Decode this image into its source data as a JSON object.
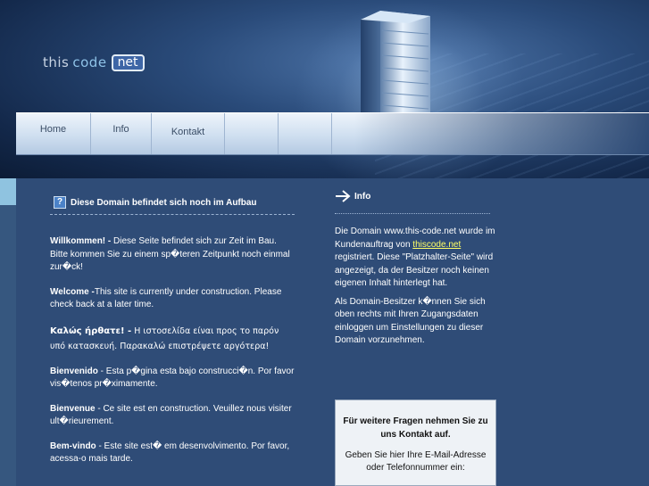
{
  "logo": {
    "part1": "this",
    "part2": "code",
    "part3": "net"
  },
  "nav": {
    "home": "Home",
    "info": "Info",
    "kontakt": "Kontakt"
  },
  "main": {
    "title": "Diese Domain befindet sich noch im Aufbau",
    "paragraphs": [
      {
        "lead": "Willkommen! -",
        "text": " Diese Seite befindet sich zur Zeit im Bau. Bitte kommen Sie zu einem sp�teren Zeitpunkt noch einmal zur�ck!"
      },
      {
        "lead": "Welcome -",
        "text": "This site is currently under construction. Please check back at a later time."
      },
      {
        "lead": "Καλώς ήρθατε! -",
        "text": " Η ιστοσελίδα είναι προς το παρόν υπό κατασκευή. Παρακαλώ επιστρέψετε αργότερα!"
      },
      {
        "lead": "Bienvenido",
        "text": " - Esta p�gina esta bajo construcci�n. Por favor vis�tenos pr�ximamente."
      },
      {
        "lead": "Bienvenue",
        "text": " - Ce site est en construction. Veuillez nous visiter ult�rieurement."
      },
      {
        "lead": "Bem-vindo",
        "text": " - Este site est� em desenvolvimento. Por favor, acessa-o mais tarde."
      }
    ]
  },
  "info": {
    "title": "Info",
    "text_before": "Die Domain www.this-code.net wurde im Kundenauftrag von ",
    "link": "thiscode.net",
    "text_after": " registriert. Diese \"Platzhalter-Seite\" wird angezeigt, da der Besitzer noch keinen eigenen Inhalt hinterlegt hat.",
    "text2": "Als Domain-Besitzer k�nnen Sie sich oben rechts mit Ihren Zugangsdaten einloggen um Einstellungen zu dieser Domain vorzunehmen."
  },
  "contact": {
    "heading": "Für weitere Fragen nehmen Sie zu uns Kontakt auf.",
    "sub": "Geben Sie hier Ihre E-Mail-Adresse oder Telefonnummer ein:"
  },
  "colors": {
    "background": "#2d4a74",
    "link": "#ffff66",
    "nav_band": "#cfdff0"
  },
  "icons": {
    "title_icon": "help-icon",
    "info_icon": "arrow-right-icon",
    "hero": "server-tower-icon"
  }
}
